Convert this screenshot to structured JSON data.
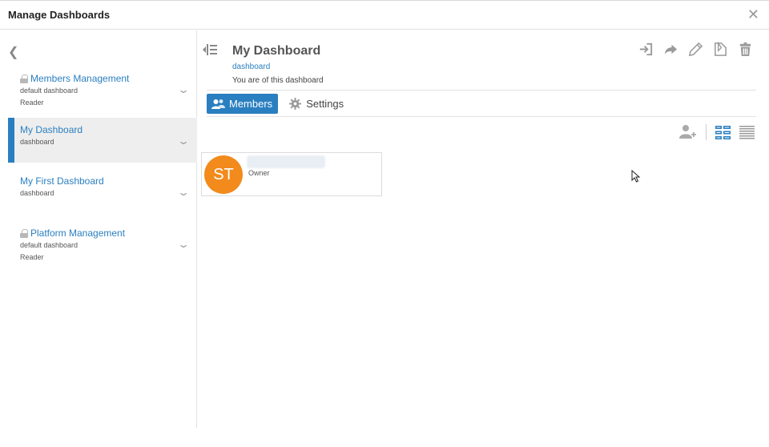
{
  "modal": {
    "title": "Manage Dashboards",
    "close_glyph": "✕"
  },
  "sidebar": {
    "back_glyph": "❮",
    "items": [
      {
        "title": "Members Management",
        "type": "default dashboard",
        "role": "Reader",
        "locked": true
      },
      {
        "title": "My Dashboard",
        "type": "dashboard",
        "role": "",
        "locked": false,
        "active": true
      },
      {
        "title": "My First Dashboard",
        "type": "dashboard",
        "role": "",
        "locked": false
      },
      {
        "title": "Platform Management",
        "type": "default dashboard",
        "role": "Reader",
        "locked": true
      }
    ]
  },
  "dashboard": {
    "title": "My Dashboard",
    "type": "dashboard",
    "role_text": "You are of this dashboard"
  },
  "tabs": {
    "members": "Members",
    "settings": "Settings"
  },
  "members": [
    {
      "initials": "ST",
      "role": "Owner",
      "avatar_color": "#f28a1c"
    }
  ],
  "colors": {
    "accent": "#2a7fc0",
    "avatar": "#f28a1c"
  },
  "icons": [
    "collapse-sidebar-icon",
    "sign-in-icon",
    "share-icon",
    "edit-icon",
    "copy-icon",
    "trash-icon",
    "add-member-icon",
    "grid-view-icon",
    "list-view-icon",
    "lock-icon",
    "chevron-down-icon",
    "gear-icon",
    "users-icon"
  ]
}
